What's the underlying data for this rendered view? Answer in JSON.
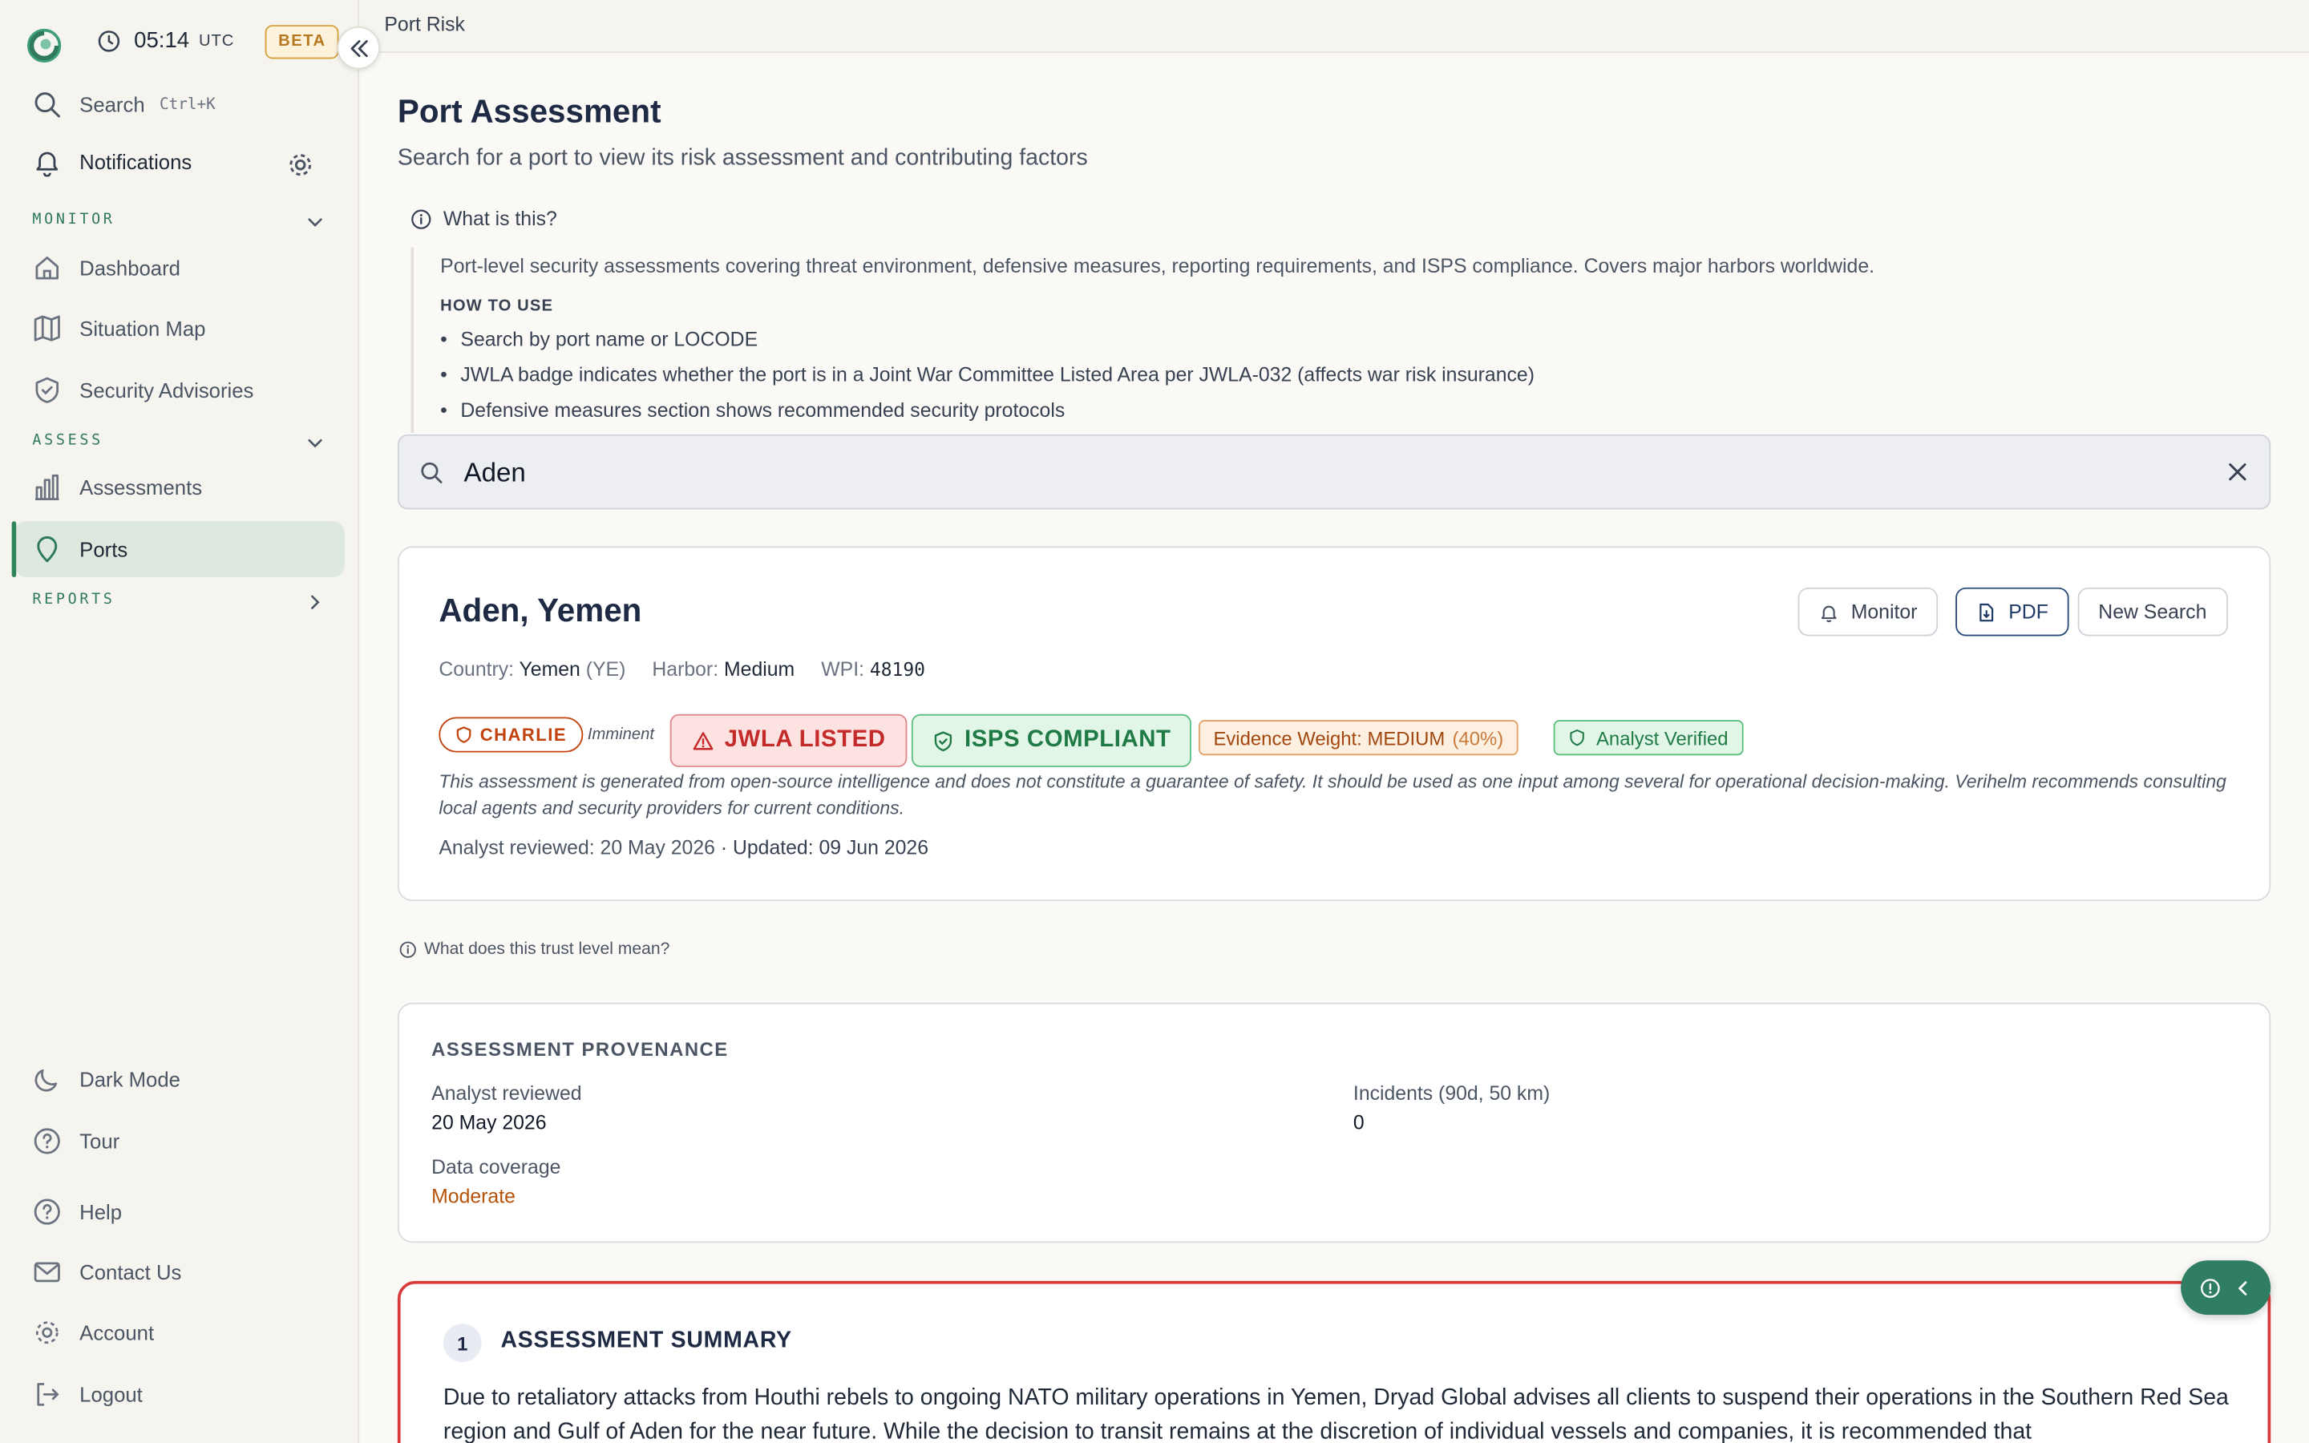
{
  "app": {
    "clock_time": "05:14",
    "clock_tz": "UTC",
    "beta_label": "BETA",
    "accent_color": "#2f7a5a"
  },
  "sidebar": {
    "search_label": "Search",
    "search_shortcut": "Ctrl+K",
    "notifications_label": "Notifications",
    "sections": {
      "monitor": "MONITOR",
      "assess": "ASSESS",
      "reports": "REPORTS"
    },
    "items": {
      "dashboard": "Dashboard",
      "situation_map": "Situation Map",
      "security_advisories": "Security Advisories",
      "assessments": "Assessments",
      "ports": "Ports"
    },
    "bottom": {
      "dark_mode": "Dark Mode",
      "tour": "Tour",
      "help": "Help",
      "contact": "Contact Us",
      "account": "Account",
      "logout": "Logout"
    }
  },
  "topbar": {
    "breadcrumb": "Port Risk"
  },
  "page": {
    "title": "Port Assessment",
    "subtitle": "Search for a port to view its risk assessment and contributing factors",
    "what_is_this": "What is this?",
    "info_text": "Port-level security assessments covering threat environment, defensive measures, reporting requirements, and ISPS compliance. Covers major harbors worldwide.",
    "how_to_use": "HOW TO USE",
    "bullets": [
      "Search by port name or LOCODE",
      "JWLA badge indicates whether the port is in a Joint War Committee Listed Area per JWLA-032 (affects war risk insurance)",
      "Defensive measures section shows recommended security protocols"
    ]
  },
  "search": {
    "value": "Aden",
    "placeholder": "Search ports"
  },
  "port": {
    "name": "Aden, Yemen",
    "buttons": {
      "monitor": "Monitor",
      "pdf": "PDF",
      "new_search": "New Search"
    },
    "country_label": "Country:",
    "country_value": "Yemen",
    "country_code": "(YE)",
    "harbor_label": "Harbor:",
    "harbor_value": "Medium",
    "wpi_label": "WPI:",
    "wpi_value": "48190",
    "threat_level": "CHARLIE",
    "threat_qualifier": "Imminent",
    "jwla": "JWLA LISTED",
    "isps": "ISPS COMPLIANT",
    "evidence_label": "Evidence Weight: MEDIUM",
    "evidence_pct": "(40%)",
    "verified": "Analyst Verified",
    "disclaimer": "This assessment is generated from open-source intelligence and does not constitute a guarantee of safety. It should be used as one input among several for operational decision-making. Verihelm recommends consulting local agents and security providers for current conditions.",
    "reviewed": "Analyst reviewed: 20 May 2026",
    "updated": "· Updated: 09 Jun 2026"
  },
  "trust_link": "What does this trust level mean?",
  "provenance": {
    "title": "ASSESSMENT PROVENANCE",
    "analyst_reviewed_label": "Analyst reviewed",
    "analyst_reviewed_value": "20 May 2026",
    "incidents_label": "Incidents (90d, 50 km)",
    "incidents_value": "0",
    "coverage_label": "Data coverage",
    "coverage_value": "Moderate"
  },
  "summary": {
    "number": "1",
    "title": "ASSESSMENT SUMMARY",
    "body": "Due to retaliatory attacks from Houthi rebels to ongoing NATO military operations in Yemen, Dryad Global advises all clients to suspend their operations in the Southern Red Sea region and Gulf of Aden for the near future. While the decision to transit remains at the discretion of individual vessels and companies, it is recommended that"
  }
}
